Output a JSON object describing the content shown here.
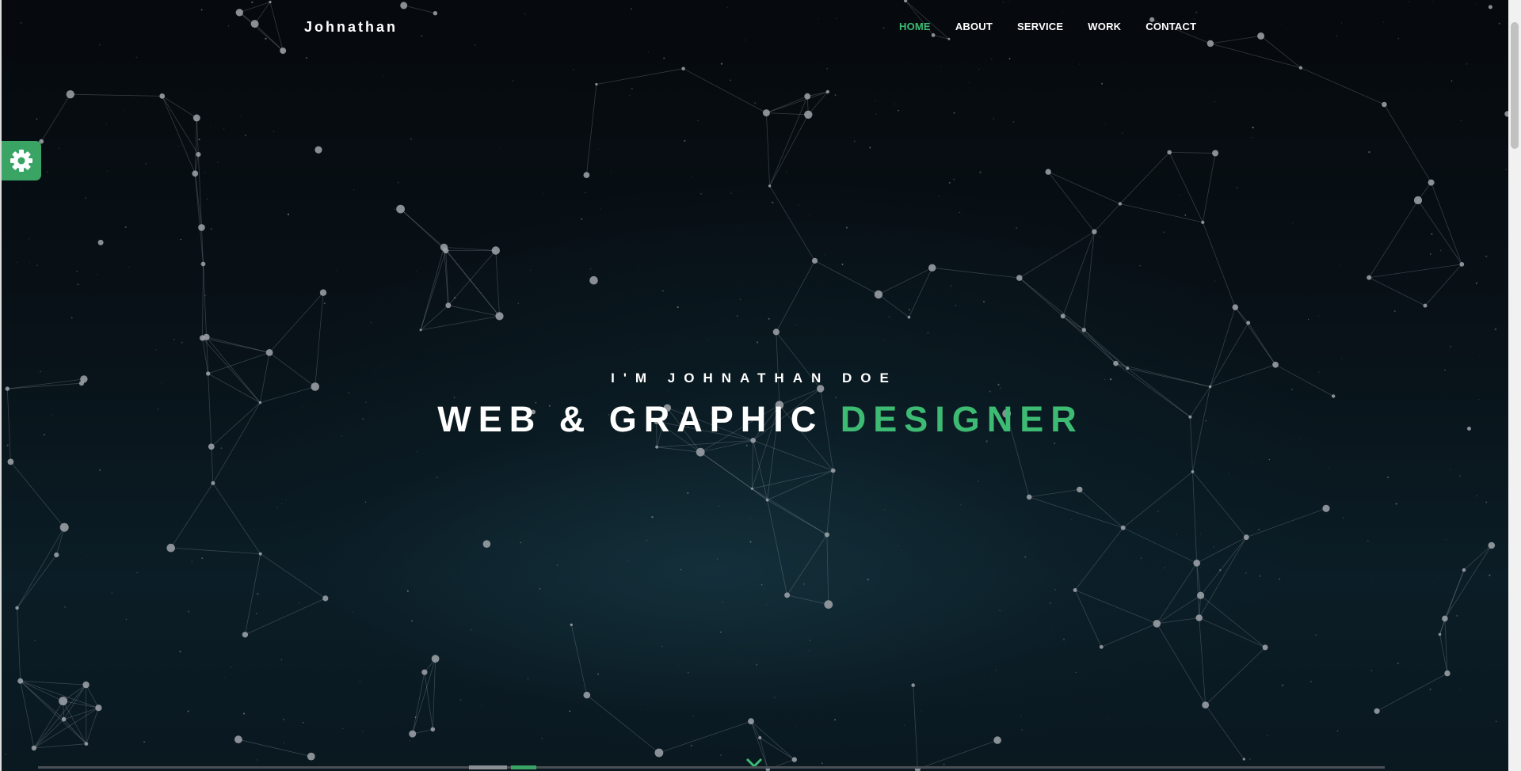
{
  "brand": {
    "logo_text": "Johnathan",
    "accent_color": "#3dbb73"
  },
  "nav": {
    "items": [
      {
        "label": "HOME",
        "active": true
      },
      {
        "label": "ABOUT",
        "active": false
      },
      {
        "label": "SERVICE",
        "active": false
      },
      {
        "label": "WORK",
        "active": false
      },
      {
        "label": "CONTACT",
        "active": false
      }
    ]
  },
  "settings": {
    "icon": "gear-icon"
  },
  "hero": {
    "intro": "I'M JOHNATHAN DOE",
    "headline_main": "WEB & GRAPHIC",
    "headline_accent": "DESIGNER",
    "scroll_icon": "chevron-down-icon"
  }
}
